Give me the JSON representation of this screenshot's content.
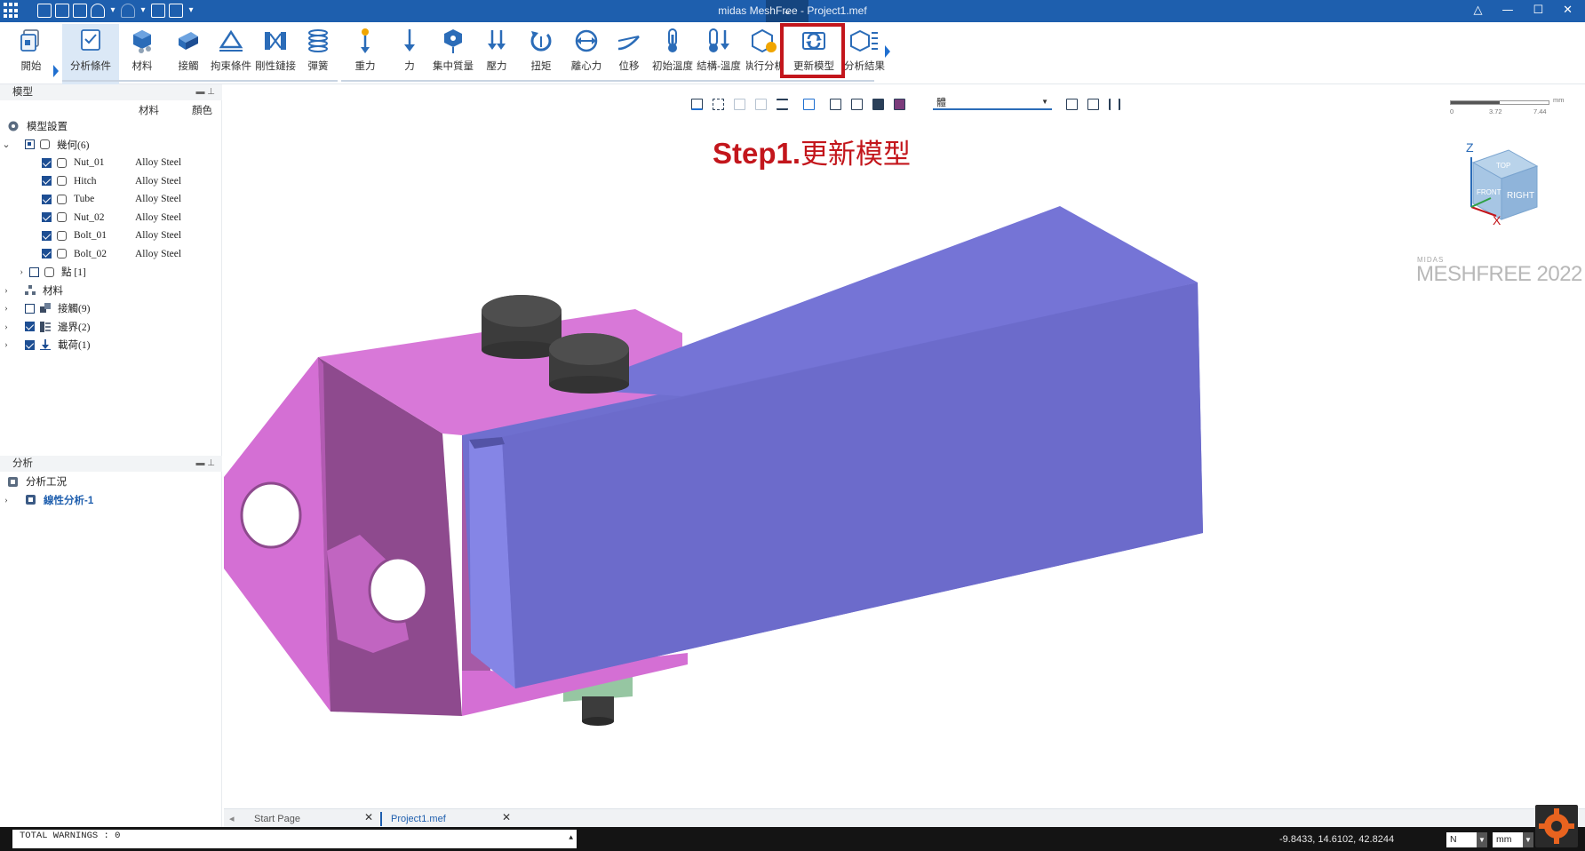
{
  "titlebar": {
    "title": "midas MeshFree - Project1.mef"
  },
  "ribbon": {
    "buttons": [
      {
        "label": "開始",
        "icon": "home-stack-icon"
      },
      {
        "label": "分析條件",
        "icon": "analysis-conditions-icon"
      },
      {
        "label": "材料",
        "icon": "material-icon"
      },
      {
        "label": "接觸",
        "icon": "contact-icon"
      },
      {
        "label": "拘束條件",
        "icon": "constraint-icon"
      },
      {
        "label": "剛性鏈接",
        "icon": "rigid-link-icon"
      },
      {
        "label": "彈簧",
        "icon": "spring-icon"
      },
      {
        "label": "重力",
        "icon": "gravity-icon"
      },
      {
        "label": "力",
        "icon": "force-icon"
      },
      {
        "label": "集中質量",
        "icon": "point-mass-icon"
      },
      {
        "label": "壓力",
        "icon": "pressure-icon"
      },
      {
        "label": "扭矩",
        "icon": "torque-icon"
      },
      {
        "label": "離心力",
        "icon": "centrifugal-icon"
      },
      {
        "label": "位移",
        "icon": "displacement-icon"
      },
      {
        "label": "初始溫度",
        "icon": "initial-temperature-icon"
      },
      {
        "label": "結構-溫度",
        "icon": "structure-temperature-icon"
      },
      {
        "label": "執行分析",
        "icon": "run-analysis-icon"
      },
      {
        "label": "更新模型",
        "icon": "update-model-icon"
      },
      {
        "label": "分析結果",
        "icon": "analysis-results-icon"
      }
    ]
  },
  "model_panel": {
    "title": "模型",
    "col_material": "材料",
    "col_color": "顏色",
    "root": "模型設置",
    "geometry_label": "幾何(6)",
    "parts": [
      {
        "name": "Nut_01",
        "material": "Alloy Steel"
      },
      {
        "name": "Hitch",
        "material": "Alloy Steel"
      },
      {
        "name": "Tube",
        "material": "Alloy Steel"
      },
      {
        "name": "Nut_02",
        "material": "Alloy Steel"
      },
      {
        "name": "Bolt_01",
        "material": "Alloy Steel"
      },
      {
        "name": "Bolt_02",
        "material": "Alloy Steel"
      }
    ],
    "points": "點 [1]",
    "materials": "材料",
    "contacts": "接觸(9)",
    "boundaries": "邊界(2)",
    "loads": "載荷(1)"
  },
  "analysis_panel": {
    "title": "分析",
    "root": "分析工況",
    "case": "線性分析-1"
  },
  "viewport": {
    "view_select": "體",
    "step_prefix": "Step1.",
    "step_text": "更新模型",
    "brand_small": "MIDAS",
    "brand": "MESHFREE 2022",
    "scale_unit": "mm",
    "scale_ticks": [
      "0",
      "3.72",
      "7.44"
    ],
    "axis_z": "Z",
    "axis_x": "X",
    "cube_top": "TOP",
    "cube_front": "FRONT",
    "cube_right": "RIGHT"
  },
  "tabs": [
    {
      "label": "Start Page"
    },
    {
      "label": "Project1.mef"
    }
  ],
  "status": {
    "warnings": "TOTAL WARNINGS : 0",
    "coords": "-9.8433, 14.6102, 42.8244",
    "force_unit": "N",
    "length_unit": "mm"
  },
  "colors": {
    "titlebar": "#1e5fae",
    "accent": "#1f6fd0",
    "highlight": "#c3161c",
    "hitch": "#d66fd6",
    "tube": "#6f6fcf"
  }
}
